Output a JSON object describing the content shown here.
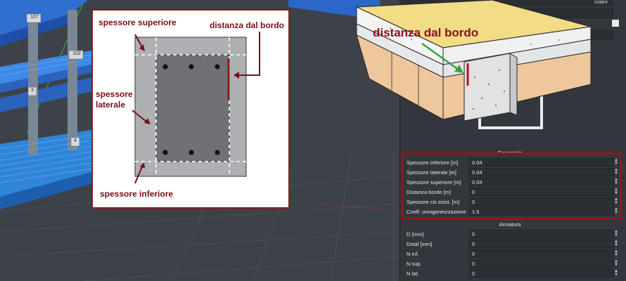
{
  "viewport": {
    "column_tags": [
      "107",
      "102",
      "3",
      "4"
    ]
  },
  "section_diagram": {
    "label_top": "spessore superiore",
    "label_edge": "distanza dal bordo",
    "label_side": "spessore laterale",
    "label_bottom": "spessore inferiore"
  },
  "inset": {
    "label": "distanza dal bordo"
  },
  "panel": {
    "header_partial": "colare",
    "geometry_title": "Geometria",
    "params": [
      {
        "label": "Spessore inferiore [m]",
        "value": "0.04"
      },
      {
        "label": "Spessore laterale [m]",
        "value": "0.04"
      },
      {
        "label": "Spessore superiore [m]",
        "value": "0.04"
      },
      {
        "label": "Distanza bordo [m]",
        "value": "0"
      },
      {
        "label": "Spessore cls esist. [m]",
        "value": "0"
      },
      {
        "label": "Coeff. omogeneizzazione",
        "value": "1.5"
      }
    ],
    "reinforcement_title": "Armatura",
    "reinf": [
      {
        "label": "D [mm]",
        "value": "0"
      },
      {
        "label": "Dstaf [mm]",
        "value": "0"
      },
      {
        "label": "N inf.",
        "value": "0"
      },
      {
        "label": "N sup.",
        "value": "0"
      },
      {
        "label": "N lat.",
        "value": "0"
      }
    ]
  },
  "colors": {
    "accent_frame": "#8a1a1a",
    "label_red": "#7a0e16",
    "structure_blue": "#2f7fd6",
    "panel_bg": "#33373d"
  }
}
